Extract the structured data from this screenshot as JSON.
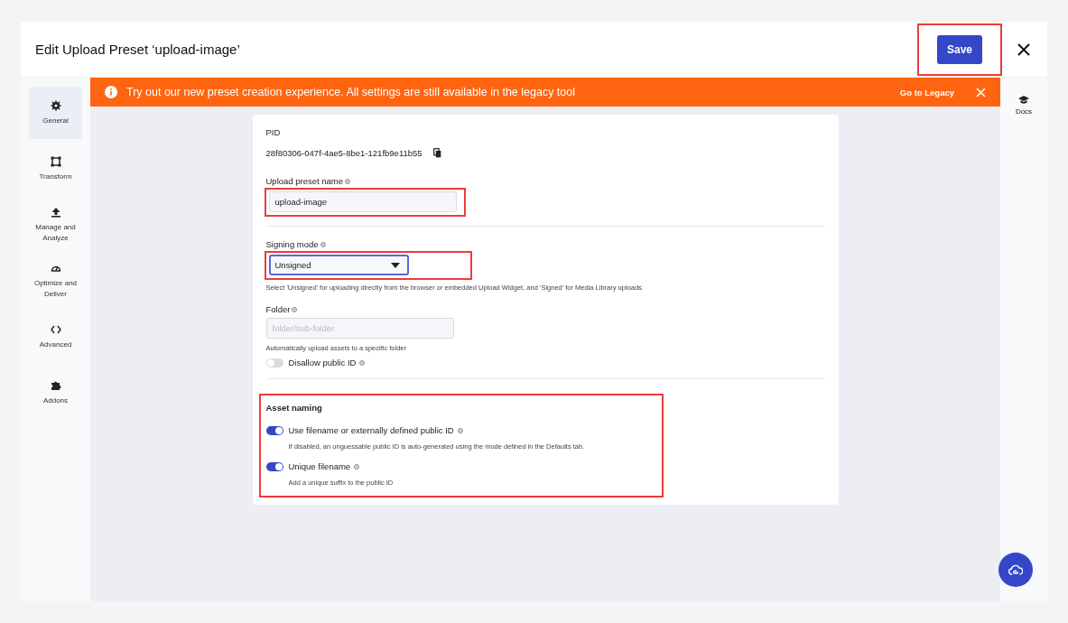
{
  "header": {
    "title": "Edit Upload Preset ‘upload-image’",
    "save_button": {
      "label": "Save",
      "highlighted": true
    }
  },
  "sidebar": {
    "items": [
      {
        "label": "General",
        "selected": true
      },
      {
        "label": "Transform",
        "selected": false
      },
      {
        "label": "Manage and Analyze",
        "selected": false
      },
      {
        "label": "Optimize and Deliver",
        "selected": false
      },
      {
        "label": "Advanced",
        "selected": false
      },
      {
        "label": "Addons",
        "selected": false
      }
    ]
  },
  "banner": {
    "text": "Try out our new preset creation experience. All settings are still available in the legacy tool",
    "link": "Go to Legacy"
  },
  "form": {
    "pid_label": "PID",
    "pid": "28f80306-047f-4ae5-8be1-121fb9e11b55",
    "name": {
      "label": "Upload preset name",
      "value": "upload-image",
      "highlighted": true
    },
    "signing": {
      "label": "Signing mode",
      "value": "Unsigned",
      "help": "Select 'Unsigned' for uploading directly from the browser or embedded Upload Widget, and 'Signed' for Media Library uploads.",
      "highlighted": true
    },
    "folder": {
      "label": "Folder",
      "placeholder": "folder/sub-folder",
      "help": "Automatically upload assets to a specific folder"
    },
    "disallow": {
      "label": "Disallow public ID",
      "on": false
    },
    "asset_naming": {
      "title": "Asset naming",
      "highlighted": true,
      "toggles": [
        {
          "label": "Use filename or externally defined public ID",
          "on": true,
          "help": "If disabled, an unguessable public ID is auto-generated using the mode defined in the Defaults tab."
        },
        {
          "label": "Unique filename",
          "on": true,
          "help": "Add a unique suffix to the public ID"
        }
      ]
    }
  },
  "right_rail": {
    "docs": "Docs"
  }
}
